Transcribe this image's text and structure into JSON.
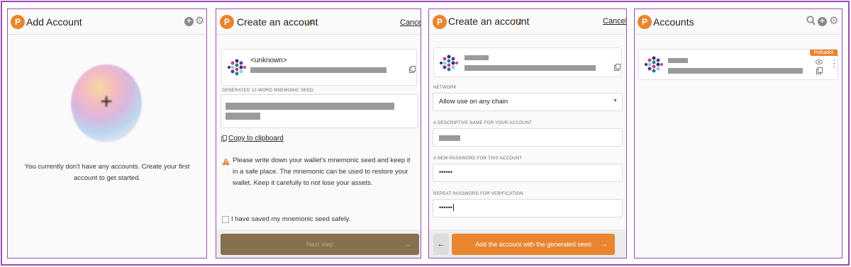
{
  "accent_color": "#e9852e",
  "frame_color": "#9b4cb0",
  "panel1": {
    "title": "Add Account",
    "logo_letter": "P",
    "plus_sign": "+",
    "empty_message": "You currently don't have any accounts. Create your first account to get started."
  },
  "panel2": {
    "title": "Create an account",
    "step_current": "1",
    "step_total": "/2",
    "cancel": "Cancel",
    "account_name": "<unknown>",
    "seed_label": "GENERATED 12-WORD MNEMONIC SEED:",
    "copy_label": "Copy to clipboard",
    "warning": "Please write down your wallet's mnemonic seed and keep it in a safe place. The mnemonic can be used to restore your wallet. Keep it carefully to not lose your assets.",
    "checkbox_label": "I have saved my mnemonic seed safely.",
    "next_button": "Next step",
    "next_arrow": "→"
  },
  "panel3": {
    "title": "Create an account",
    "step_current": "2",
    "step_total": "/2",
    "cancel": "Cancel",
    "network_label": "NETWORK",
    "network_value": "Allow use on any chain",
    "name_label": "A DESCRIPTIVE NAME FOR YOUR ACCOUNT",
    "password_label": "A NEW PASSWORD FOR THIS ACCOUNT",
    "password_value": "••••••",
    "repeat_label": "REPEAT PASSWORD FOR VERIFICATION",
    "repeat_value": "••••••",
    "back_arrow": "←",
    "add_button": "Add the account with the generated seed",
    "add_arrow": "→"
  },
  "panel4": {
    "title": "Accounts",
    "badge": "Polkadot",
    "menu_dots": "⋮"
  },
  "icons": {
    "logo": "polkadot-logo-icon",
    "add": "plus-circle-icon",
    "settings": "gear-icon",
    "search": "search-icon",
    "copy": "copy-icon",
    "warning": "warning-icon",
    "eye": "eye-icon"
  }
}
